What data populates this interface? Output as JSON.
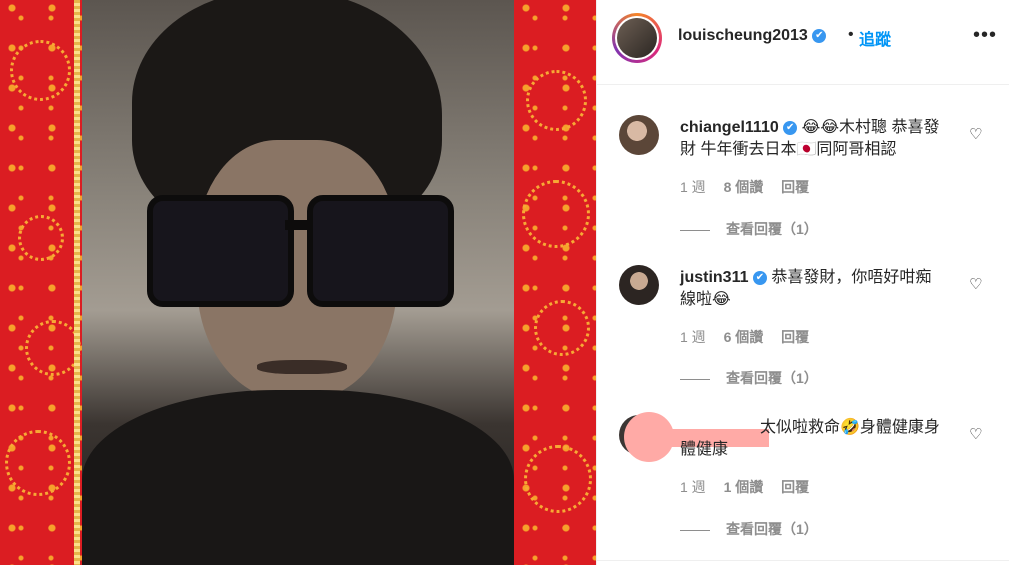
{
  "header": {
    "username": "louischeung2013",
    "verified_mark": "✔",
    "separator": "•",
    "follow_label": "追蹤",
    "more_label": "•••"
  },
  "comments": [
    {
      "username": "chiangel1110",
      "verified_mark": "✔",
      "text": "😂😂木村聰 恭喜發財 牛年衝去日本🇯🇵同阿哥相認",
      "time": "1 週",
      "likes": "8 個讚",
      "reply_label": "回覆",
      "view_replies": "查看回覆（1）"
    },
    {
      "username": "justin311",
      "verified_mark": "✔",
      "text": "恭喜發財，你唔好咁痴線啦😂",
      "time": "1 週",
      "likes": "6 個讚",
      "reply_label": "回覆",
      "view_replies": "查看回覆（1）"
    },
    {
      "username": "",
      "text": "太似啦救命🤣身體健康身體健康",
      "time": "1 週",
      "likes": "1 個讚",
      "reply_label": "回覆",
      "view_replies": "查看回覆（1）"
    }
  ],
  "icons": {
    "heart": "♡"
  },
  "colors": {
    "follow_blue": "#0095f6",
    "verified_blue": "#3897f0",
    "border_red": "#db1d22",
    "gold": "#e6b64a"
  }
}
